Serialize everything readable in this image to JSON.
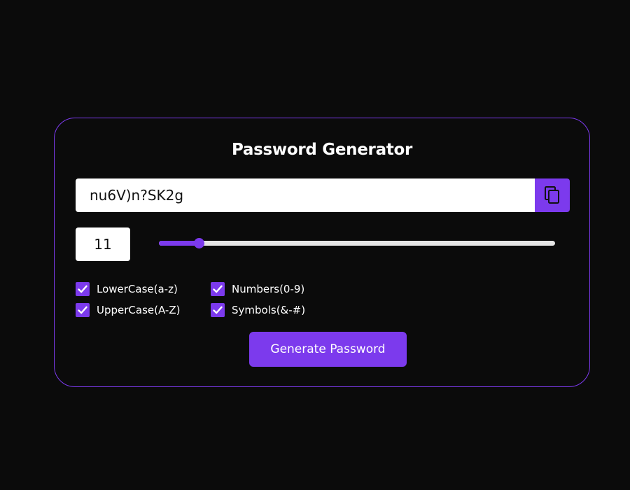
{
  "app": {
    "title": "Password Generator"
  },
  "password": {
    "value": "nu6V)n?SK2g"
  },
  "copy_button": {
    "icon": "copy-icon"
  },
  "length": {
    "value": "11",
    "fraction": 0.1
  },
  "options": [
    {
      "label": "LowerCase(a-z)",
      "checked": true
    },
    {
      "label": "Numbers(0-9)",
      "checked": true
    },
    {
      "label": "UpperCase(A-Z)",
      "checked": true
    },
    {
      "label": "Symbols(&-#)",
      "checked": true
    }
  ],
  "generate_button": {
    "label": "Generate Password"
  },
  "colors": {
    "background": "#0b0b0b",
    "accent": "#7c3aed",
    "text": "#ffffff"
  }
}
